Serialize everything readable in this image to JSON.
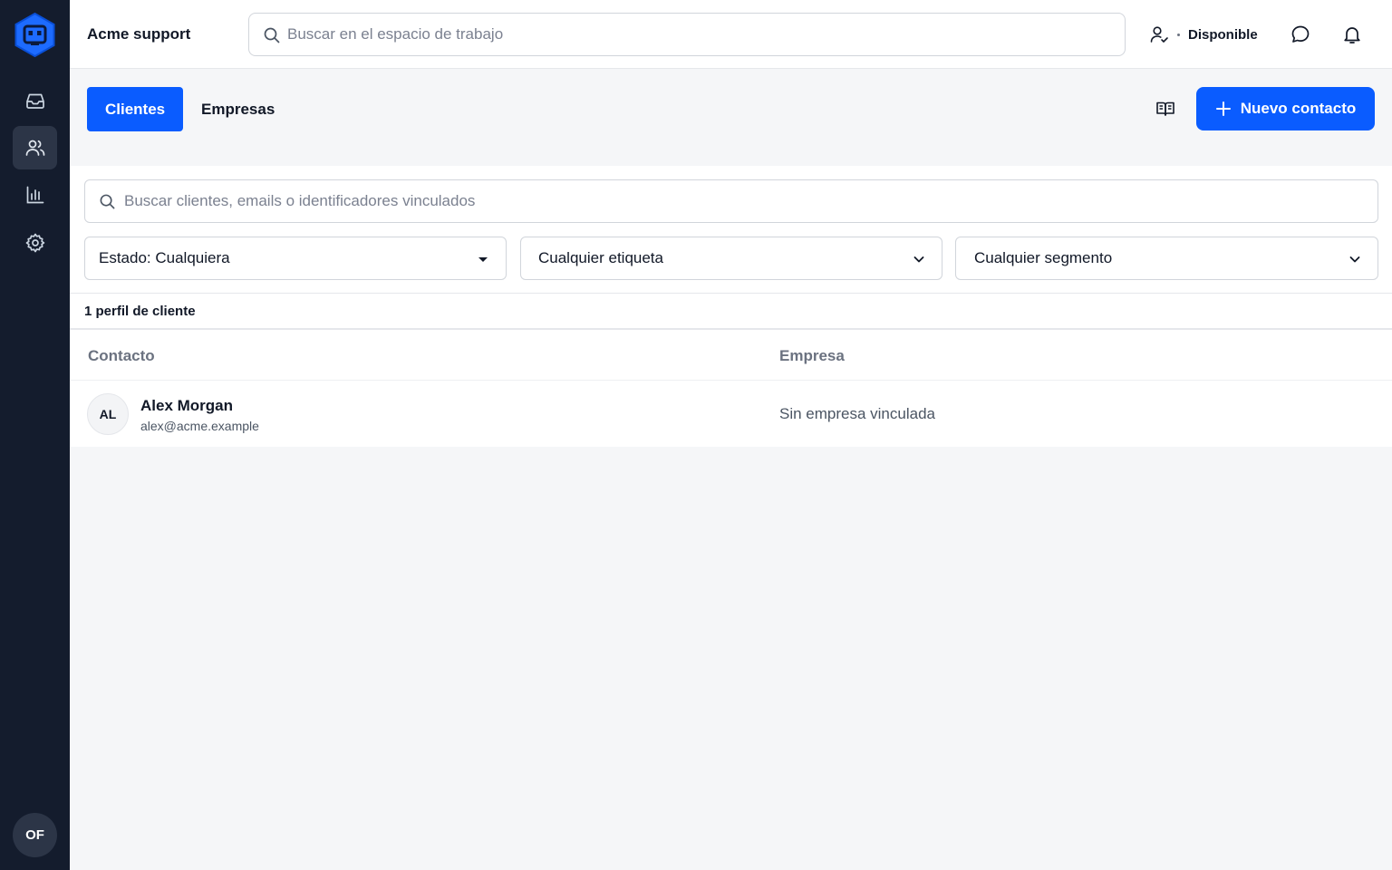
{
  "colors": {
    "accent": "#0a5cff",
    "rail_bg": "#141c2d",
    "rail_active": "#2c3547"
  },
  "rail": {
    "items": [
      {
        "name": "inbox-icon",
        "active": false
      },
      {
        "name": "users-icon",
        "active": true
      },
      {
        "name": "chart-icon",
        "active": false
      },
      {
        "name": "gear-icon",
        "active": false
      }
    ],
    "avatar_initials": "OF"
  },
  "topbar": {
    "workspace": "Acme support",
    "search_placeholder": "Buscar en el espacio de trabajo",
    "status": "Disponible"
  },
  "tabs": [
    {
      "label": "Clientes",
      "active": true
    },
    {
      "label": "Empresas",
      "active": false
    }
  ],
  "new_contact_label": "Nuevo contacto",
  "filters": {
    "search_placeholder": "Buscar clientes, emails o identificadores vinculados",
    "status": "Estado: Cualquiera",
    "tag": "Cualquier etiqueta",
    "segment": "Cualquier segmento"
  },
  "result_count": "1 perfil de cliente",
  "table": {
    "columns": [
      "Contacto",
      "Empresa"
    ],
    "rows": [
      {
        "initials": "AL",
        "name": "Alex Morgan",
        "email": "alex@acme.example",
        "company": "Sin empresa vinculada"
      }
    ]
  }
}
